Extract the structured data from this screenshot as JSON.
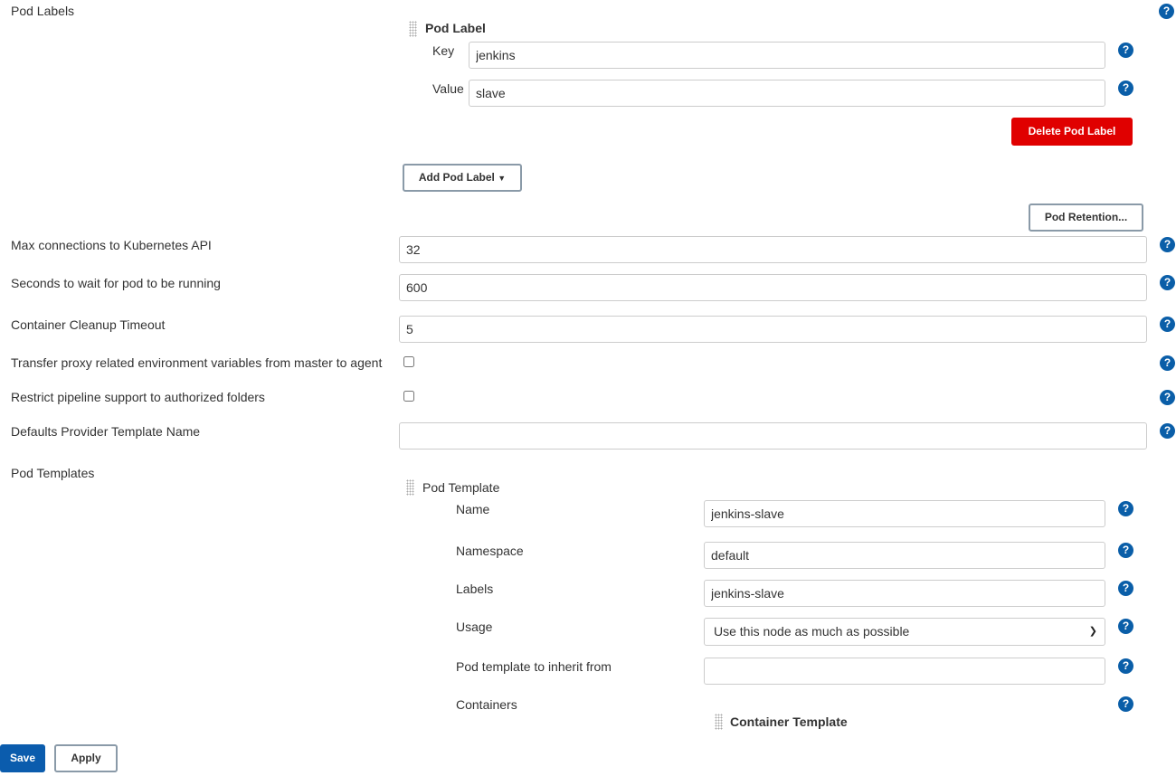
{
  "pod_labels": {
    "label": "Pod Labels",
    "item_title": "Pod Label",
    "key_label": "Key",
    "key_value": "jenkins",
    "value_label": "Value",
    "value_value": "slave",
    "delete_label": "Delete Pod Label",
    "add_label": "Add Pod Label"
  },
  "pod_retention_label": "Pod Retention...",
  "fields": {
    "max_connections": {
      "label": "Max connections to Kubernetes API",
      "value": "32"
    },
    "seconds_wait": {
      "label": "Seconds to wait for pod to be running",
      "value": "600"
    },
    "cleanup_timeout": {
      "label": "Container Cleanup Timeout",
      "value": "5"
    },
    "transfer_proxy": {
      "label": "Transfer proxy related environment variables from master to agent",
      "checked": false
    },
    "restrict_pipeline": {
      "label": "Restrict pipeline support to authorized folders",
      "checked": false
    },
    "defaults_provider": {
      "label": "Defaults Provider Template Name",
      "value": ""
    }
  },
  "pod_templates": {
    "label": "Pod Templates",
    "item_title": "Pod Template",
    "name": {
      "label": "Name",
      "value": "jenkins-slave"
    },
    "namespace": {
      "label": "Namespace",
      "value": "default"
    },
    "labels": {
      "label": "Labels",
      "value": "jenkins-slave"
    },
    "usage": {
      "label": "Usage",
      "value": "Use this node as much as possible"
    },
    "inherit": {
      "label": "Pod template to inherit from",
      "value": ""
    },
    "containers": {
      "label": "Containers",
      "item_title": "Container Template"
    }
  },
  "help_icon": "?",
  "footer": {
    "save": "Save",
    "apply": "Apply"
  },
  "colors": {
    "help": "#0a5ea8",
    "delete": "#e00000",
    "save": "#0b5cad"
  }
}
